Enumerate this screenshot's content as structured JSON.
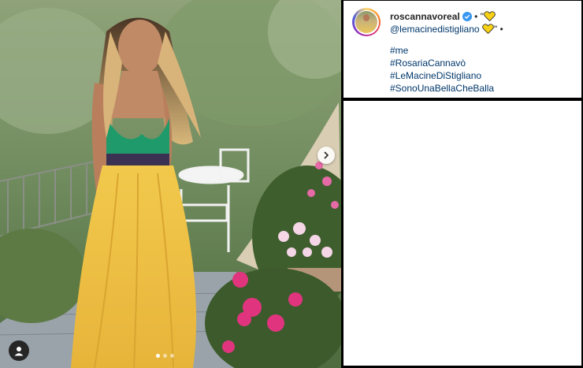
{
  "post": {
    "username": "roscannavoreal",
    "separator": "•",
    "quote_open": "\"",
    "mention": "@lemacinedistigliano",
    "quote_close": "\"",
    "bullet": "•",
    "hashtags": [
      "#me",
      "#RosariaCannavò",
      "#LeMacineDiStigliano",
      "#SonoUnaBellaCheBalla"
    ],
    "heart_color": "#f7d117",
    "verified_color": "#3897f0",
    "link_color": "#00376b"
  },
  "carousel": {
    "dot_count": 3,
    "active_index": 0,
    "next_icon": "chevron-right-icon",
    "user_icon": "user-tag-icon"
  },
  "photo": {
    "description_icon": "photo-woman-yellow-skirt"
  }
}
